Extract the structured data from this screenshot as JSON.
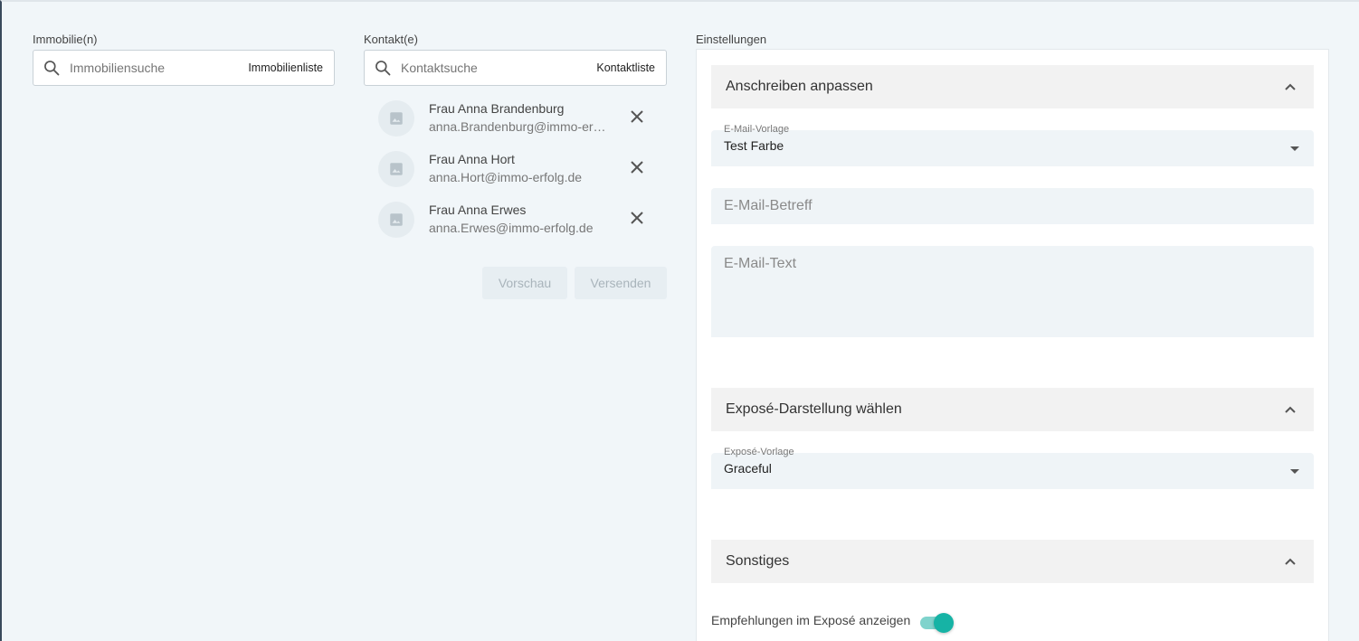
{
  "immobilie": {
    "label": "Immobilie(n)",
    "search_placeholder": "Immobiliensuche",
    "list_link": "Immobilienliste"
  },
  "kontakt": {
    "label": "Kontakt(e)",
    "search_placeholder": "Kontaktsuche",
    "list_link": "Kontaktliste",
    "contacts": [
      {
        "name": "Frau Anna Brandenburg",
        "email": "anna.Brandenburg@immo-erfolg.de"
      },
      {
        "name": "Frau Anna Hort",
        "email": "anna.Hort@immo-erfolg.de"
      },
      {
        "name": "Frau Anna Erwes",
        "email": "anna.Erwes@immo-erfolg.de"
      }
    ],
    "preview_button": "Vorschau",
    "send_button": "Versenden"
  },
  "settings": {
    "label": "Einstellungen",
    "section_letter": {
      "title": "Anschreiben anpassen",
      "template_label": "E-Mail-Vorlage",
      "template_value": "Test Farbe",
      "subject_placeholder": "E-Mail-Betreff",
      "text_placeholder": "E-Mail-Text"
    },
    "section_expose": {
      "title": "Exposé-Darstellung wählen",
      "template_label": "Exposé-Vorlage",
      "template_value": "Graceful"
    },
    "section_misc": {
      "title": "Sonstiges",
      "recommendations_label": "Empfehlungen im Exposé anzeigen",
      "recommendations_enabled": true
    }
  },
  "colors": {
    "page_bg": "#f1f6f9",
    "toggle_on": "#16b3a5",
    "toggle_track": "#7fd3cc"
  }
}
